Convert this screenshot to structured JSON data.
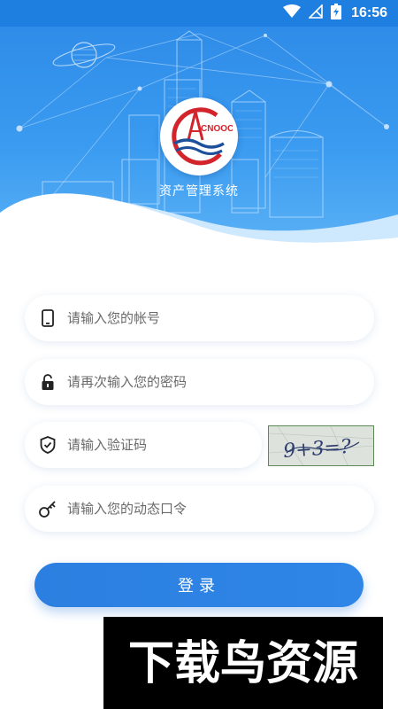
{
  "status_bar": {
    "time": "16:56",
    "icons": [
      "wifi-icon",
      "signal-icon",
      "battery-icon"
    ]
  },
  "header": {
    "logo_text": "CNOOC",
    "title": "资产管理系统"
  },
  "form": {
    "account_placeholder": "请输入您的帐号",
    "password_placeholder": "请再次输入您的密码",
    "captcha_placeholder": "请输入验证码",
    "captcha_text": "9+3=?",
    "otp_placeholder": "请输入您的动态口令",
    "icons": {
      "account": "phone-icon",
      "password": "lock-icon",
      "captcha": "shield-check-icon",
      "otp": "key-icon"
    }
  },
  "login_button": {
    "label": "登录"
  },
  "watermark": {
    "text": "下载鸟资源"
  },
  "colors": {
    "primary": "#2b7fe0",
    "header_top": "#2f8ce8",
    "header_bottom": "#59b0f5",
    "logo_red": "#d3242c",
    "logo_blue": "#1d4f9b"
  }
}
